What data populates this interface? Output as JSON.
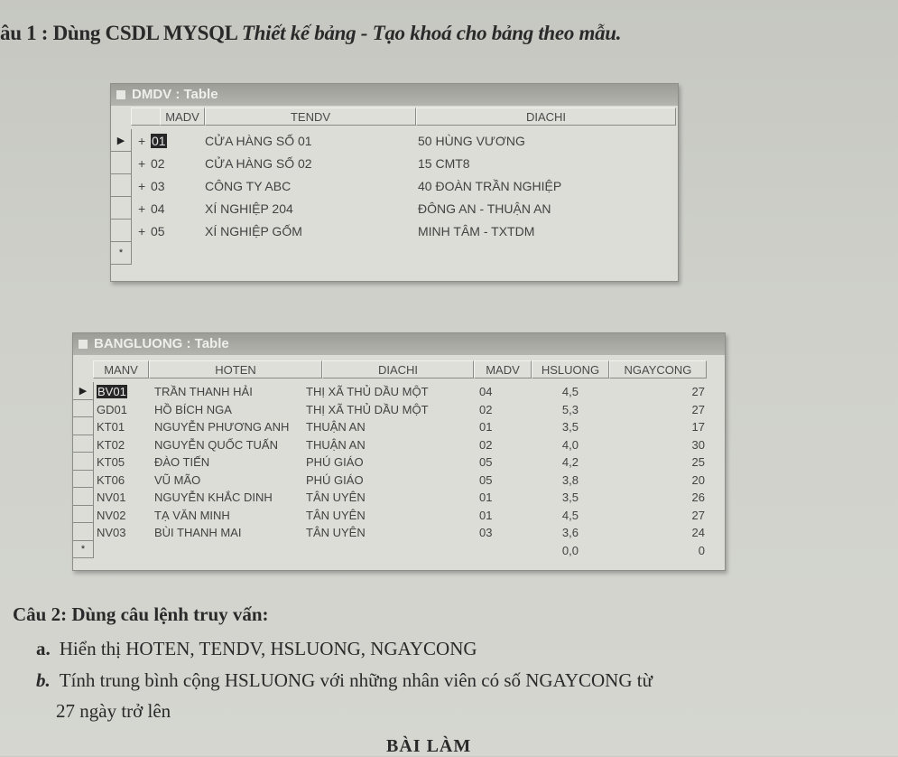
{
  "question1": {
    "prefix": "âu 1 :",
    "bold_text": "Dùng CSDL MYSQL",
    "italic_text": "Thiết kế bảng - Tạo khoá cho bảng theo mẫu."
  },
  "dmdv_table": {
    "title": "DMDV : Table",
    "columns": [
      "MADV",
      "TENDV",
      "DIACHI"
    ],
    "rows": [
      {
        "madv": "01",
        "tendv": "CỬA HÀNG SỐ 01",
        "diachi": "50 HÙNG VƯƠNG"
      },
      {
        "madv": "02",
        "tendv": "CỬA HÀNG SỐ 02",
        "diachi": "15 CMT8"
      },
      {
        "madv": "03",
        "tendv": "CÔNG TY ABC",
        "diachi": "40 ĐOÀN TRẦN NGHIỆP"
      },
      {
        "madv": "04",
        "tendv": "XÍ NGHIỆP 204",
        "diachi": "ĐÔNG AN - THUẬN AN"
      },
      {
        "madv": "05",
        "tendv": "XÍ NGHIỆP GỐM",
        "diachi": "MINH TÂM - TXTDM"
      }
    ],
    "current_row_marker": "▶",
    "expand_marker": "+",
    "new_row_marker": "*"
  },
  "bangluong_table": {
    "title": "BANGLUONG : Table",
    "columns": [
      "MANV",
      "HOTEN",
      "DIACHI",
      "MADV",
      "HSLUONG",
      "NGAYCONG"
    ],
    "rows": [
      {
        "manv": "BV01",
        "hoten": "TRẦN THANH HẢI",
        "diachi": "THỊ XÃ THỦ DẦU MỘT",
        "madv": "04",
        "hsluong": "4,5",
        "ngaycong": "27"
      },
      {
        "manv": "GD01",
        "hoten": "HỒ BÍCH NGA",
        "diachi": "THỊ XÃ THỦ DẦU MỘT",
        "madv": "02",
        "hsluong": "5,3",
        "ngaycong": "27"
      },
      {
        "manv": "KT01",
        "hoten": "NGUYỄN PHƯƠNG ANH",
        "diachi": "THUẬN AN",
        "madv": "01",
        "hsluong": "3,5",
        "ngaycong": "17"
      },
      {
        "manv": "KT02",
        "hoten": "NGUYỄN QUỐC TUẤN",
        "diachi": "THUẬN AN",
        "madv": "02",
        "hsluong": "4,0",
        "ngaycong": "30"
      },
      {
        "manv": "KT05",
        "hoten": "ĐÀO TIẾN",
        "diachi": "PHÚ GIÁO",
        "madv": "05",
        "hsluong": "4,2",
        "ngaycong": "25"
      },
      {
        "manv": "KT06",
        "hoten": "VŨ MÃO",
        "diachi": "PHÚ GIÁO",
        "madv": "05",
        "hsluong": "3,8",
        "ngaycong": "20"
      },
      {
        "manv": "NV01",
        "hoten": "NGUYỄN KHẮC DINH",
        "diachi": "TÂN UYÊN",
        "madv": "01",
        "hsluong": "3,5",
        "ngaycong": "26"
      },
      {
        "manv": "NV02",
        "hoten": "TẠ VĂN MINH",
        "diachi": "TÂN UYÊN",
        "madv": "01",
        "hsluong": "4,5",
        "ngaycong": "27"
      },
      {
        "manv": "NV03",
        "hoten": "BÙI THANH MAI",
        "diachi": "TÂN UYÊN",
        "madv": "03",
        "hsluong": "3,6",
        "ngaycong": "24"
      }
    ],
    "new_row": {
      "hsluong": "0,0",
      "ngaycong": "0"
    },
    "current_row_marker": "▶",
    "new_row_marker": "*"
  },
  "question2": {
    "heading": "Câu 2: Dùng câu lệnh truy vấn:",
    "items": [
      {
        "label": "a.",
        "text": "Hiển thị HOTEN, TENDV, HSLUONG, NGAYCONG"
      },
      {
        "label": "b.",
        "text": "Tính trung bình cộng HSLUONG với những nhân viên có số NGAYCONG từ"
      },
      {
        "label": "",
        "text": "27 ngày trở lên"
      }
    ]
  },
  "answer_heading": "BÀI LÀM"
}
